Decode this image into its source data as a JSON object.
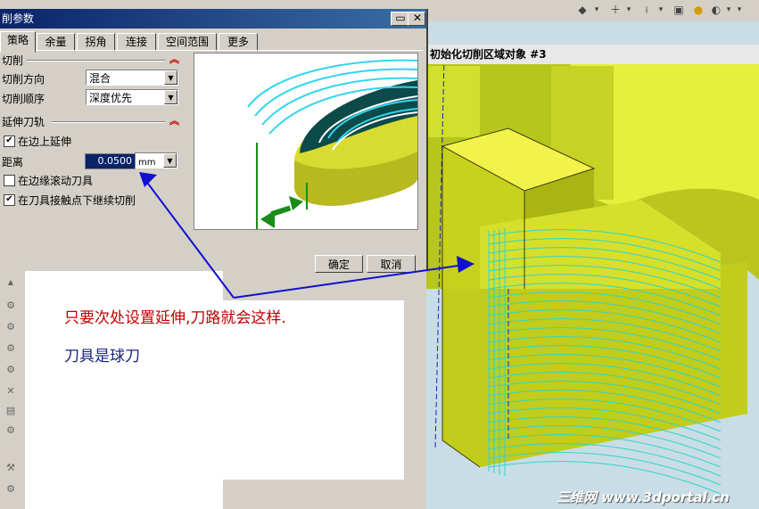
{
  "dialog": {
    "title": "削参数",
    "tabs": [
      {
        "label": "策略",
        "active": true
      },
      {
        "label": "余量",
        "active": false
      },
      {
        "label": "拐角",
        "active": false
      },
      {
        "label": "连接",
        "active": false
      },
      {
        "label": "空间范围",
        "active": false
      },
      {
        "label": "更多",
        "active": false
      }
    ],
    "cut_group": {
      "label": "切削",
      "direction_label": "切削方向",
      "direction_value": "混合",
      "order_label": "切削顺序",
      "order_value": "深度优先"
    },
    "extend_group": {
      "label": "延伸刀轨",
      "extend_at_edge_label": "在边上延伸",
      "extend_at_edge_checked": true,
      "distance_label": "距离",
      "distance_value": "0.0500",
      "distance_unit": "mm",
      "roll_tool_label": "在边缘滚动刀具",
      "roll_tool_checked": false,
      "continue_cut_label": "在刀具接触点下继续切削",
      "continue_cut_checked": true
    },
    "ok_label": "确定",
    "cancel_label": "取消"
  },
  "viewport": {
    "header": "初始化切削区域对象 #3"
  },
  "annotation": {
    "line1": "只要次处设置延伸,刀路就会这样.",
    "line2": "刀具是球刀"
  },
  "watermark": "三维网 www.3dportal.cn",
  "colors": {
    "part_yellow": "#d8e42a",
    "toolpath_cyan": "#2fd6c8",
    "arrow_blue": "#1010d0",
    "titlebar": "#0a246a"
  }
}
